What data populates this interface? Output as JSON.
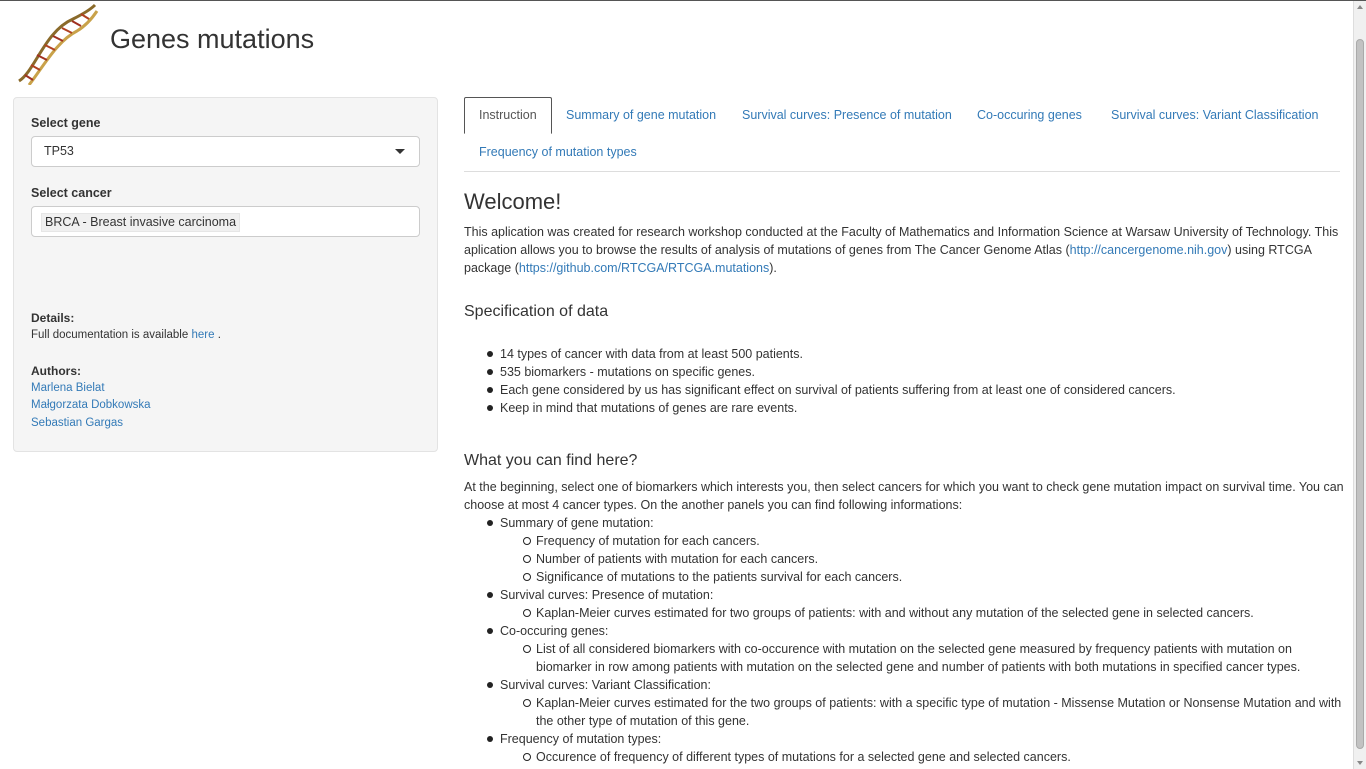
{
  "header": {
    "title": "Genes mutations"
  },
  "sidebar": {
    "gene": {
      "label": "Select gene",
      "value": "TP53"
    },
    "cancer": {
      "label": "Select cancer",
      "tag": "BRCA - Breast invasive carcinoma"
    },
    "details": {
      "title": "Details:",
      "text": "Full documentation is available",
      "link": "here",
      "end": "."
    },
    "authors": {
      "title": "Authors:",
      "list": [
        "Marlena Bielat",
        "Małgorzata Dobkowska",
        "Sebastian Gargas"
      ]
    }
  },
  "tabs": [
    "Instruction",
    "Summary of gene mutation",
    "Survival curves: Presence of mutation",
    "Co-occuring genes",
    "Survival curves: Variant Classification",
    "Frequency of mutation types"
  ],
  "main": {
    "welcome": "Welcome!",
    "intro": {
      "p1": "This aplication was created for research workshop conducted at the Faculty of Mathematics and Information Science at Warsaw University of Technology. This aplication allows you to browse the results of analysis of mutations of genes from The Cancer Genome Atlas (",
      "link1": "http://cancergenome.nih.gov",
      "p2": ") using RTCGA package (",
      "link2": "https://github.com/RTCGA/RTCGA.mutations",
      "p3": ")."
    },
    "spec_title": "Specification of data",
    "spec_items": [
      "14 types of cancer with data from at least 500 patients.",
      "535 biomarkers - mutations on specific genes.",
      "Each gene considered by us has significant effect on survival of patients suffering from at least one of considered cancers.",
      "Keep in mind that mutations of genes are rare events."
    ],
    "find_title": "What you can find here?",
    "find_intro": "At the beginning, select one of biomarkers which interests you, then select cancers for which you want to check gene mutation impact on survival time. You can choose at most 4 cancer types. On the another panels you can find following informations:",
    "find_items": [
      {
        "label": "Summary of gene mutation:",
        "sub": [
          "Frequency of mutation for each cancers.",
          "Number of patients with mutation for each cancers.",
          "Significance of mutations to the patients survival for each cancers."
        ]
      },
      {
        "label": "Survival curves: Presence of mutation:",
        "sub": [
          "Kaplan-Meier curves estimated for two groups of patients: with and without any mutation of the selected gene in selected cancers."
        ]
      },
      {
        "label": "Co-occuring genes:",
        "sub": [
          "List of all considered biomarkers with co-occurence with mutation on the selected gene measured by frequency patients with mutation on biomarker in row among patients with mutation on the selected gene and number of patients with both mutations in specified cancer types."
        ]
      },
      {
        "label": "Survival curves: Variant Classification:",
        "sub": [
          "Kaplan-Meier curves estimated for the two groups of patients: with a specific type of mutation - Missense Mutation or Nonsense Mutation and with the other type of mutation of this gene."
        ]
      },
      {
        "label": "Frequency of mutation types:",
        "sub": [
          "Occurence of frequency of different types of mutations for a selected gene and selected cancers."
        ]
      }
    ]
  }
}
